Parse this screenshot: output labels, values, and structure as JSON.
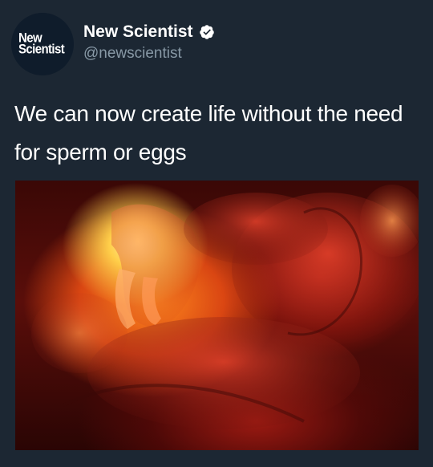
{
  "account": {
    "avatar_lines": [
      "New",
      "Scientist"
    ],
    "display_name": "New Scientist",
    "handle": "@newscientist"
  },
  "tweet": {
    "text": "We can now create life without the need for sperm or eggs"
  },
  "icons": {
    "verified": "verified-badge-icon"
  },
  "colors": {
    "background": "#1c2733",
    "handle": "#8899a6",
    "text": "#ffffff"
  }
}
